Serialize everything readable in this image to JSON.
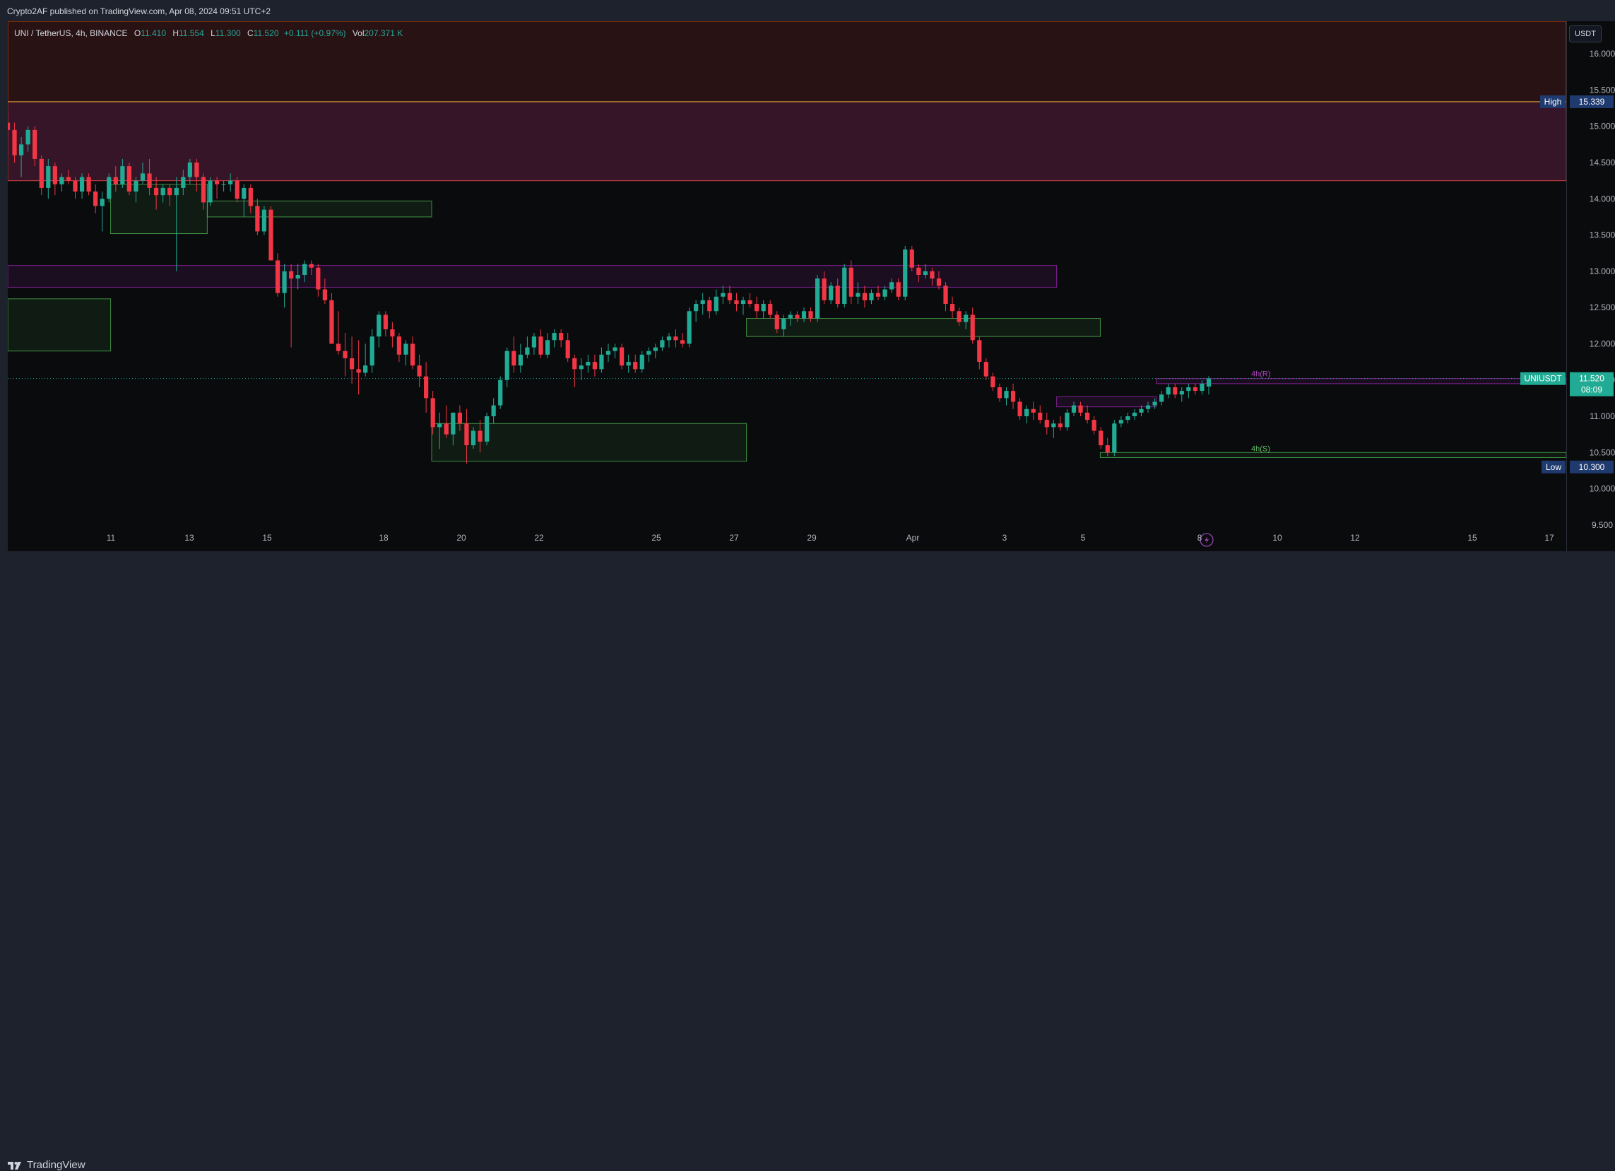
{
  "header": {
    "publisher_text": "Crypto2AF published on TradingView.com, Apr 08, 2024 09:51 UTC+2"
  },
  "legend": {
    "symbol": "UNI / TetherUS, 4h, BINANCE",
    "open_label": "O",
    "open": "11.410",
    "high_label": "H",
    "high": "11.554",
    "low_label": "L",
    "low": "11.300",
    "close_label": "C",
    "close": "11.520",
    "change": "+0.111 (+0.97%)",
    "vol_label": "Vol",
    "vol": "207.371 K"
  },
  "price_axis": {
    "currency": "USDT",
    "ticks": [
      "16.000",
      "15.500",
      "15.000",
      "14.500",
      "14.000",
      "13.500",
      "13.000",
      "12.500",
      "12.000",
      "11.500",
      "11.000",
      "10.500",
      "10.000",
      "9.500"
    ],
    "high_tag": {
      "label": "High",
      "value": "15.339"
    },
    "low_tag": {
      "label": "Low",
      "value": "10.300"
    },
    "last_tag": {
      "symbol": "UNIUSDT",
      "value": "11.520",
      "countdown": "08:09"
    }
  },
  "time_axis": {
    "ticks": [
      "11",
      "13",
      "15",
      "18",
      "20",
      "22",
      "25",
      "27",
      "29",
      "Apr",
      "3",
      "5",
      "8",
      "10",
      "12",
      "15",
      "17"
    ]
  },
  "annotations": {
    "resistance_label": "4h(R)",
    "support_label": "4h(S)"
  },
  "footer": {
    "brand": "TradingView"
  },
  "colors": {
    "up": "#22ab94",
    "down": "#f23645",
    "zone_purple": "#9c27b0",
    "zone_green": "#4caf50",
    "bg": "#0a0b0d"
  },
  "chart_data": {
    "type": "candlestick",
    "symbol": "UNIUSDT",
    "timeframe": "4h",
    "ylim": [
      9.45,
      16.45
    ],
    "x_range_days": [
      9.7,
      17.5
    ],
    "x_ticks": [
      "11",
      "13",
      "15",
      "18",
      "20",
      "22",
      "25",
      "27",
      "29",
      "Apr",
      "3",
      "5",
      "8",
      "10",
      "12",
      "15",
      "17"
    ],
    "last": {
      "open": 11.41,
      "high": 11.554,
      "low": 11.3,
      "close": 11.52
    },
    "range_high": 15.339,
    "range_low": 10.3,
    "zones": [
      {
        "kind": "supply",
        "from": "top",
        "y1": 14.25,
        "y2": 16.45
      },
      {
        "kind": "resistance",
        "y1": 12.78,
        "y2": 13.08,
        "x_start": 0,
        "x_end": 0.673
      },
      {
        "kind": "demand",
        "y1": 11.9,
        "y2": 12.62,
        "x_start": 0.0,
        "x_end": 0.066
      },
      {
        "kind": "demand",
        "y1": 13.52,
        "y2": 14.2,
        "x_start": 0.066,
        "x_end": 0.128
      },
      {
        "kind": "demand",
        "y1": 13.75,
        "y2": 13.97,
        "x_start": 0.128,
        "x_end": 0.272
      },
      {
        "kind": "demand",
        "y1": 10.38,
        "y2": 10.9,
        "x_start": 0.272,
        "x_end": 0.474
      },
      {
        "kind": "demand",
        "y1": 12.1,
        "y2": 12.35,
        "x_start": 0.474,
        "x_end": 0.701
      },
      {
        "kind": "resistance",
        "y1": 11.13,
        "y2": 11.27,
        "x_start": 0.673,
        "x_end": 0.737
      },
      {
        "kind": "4h_resistance",
        "y1": 11.45,
        "y2": 11.52,
        "x_start": 0.737,
        "x_end": 1.0
      },
      {
        "kind": "4h_support",
        "y1": 10.43,
        "y2": 10.5,
        "x_start": 0.701,
        "x_end": 1.0
      }
    ],
    "candles": [
      [
        15.05,
        15.2,
        14.6,
        14.95
      ],
      [
        14.95,
        15.05,
        14.5,
        14.6
      ],
      [
        14.6,
        14.85,
        14.3,
        14.75
      ],
      [
        14.75,
        15.0,
        14.65,
        14.95
      ],
      [
        14.95,
        15.0,
        14.45,
        14.55
      ],
      [
        14.55,
        14.6,
        14.05,
        14.15
      ],
      [
        14.15,
        14.55,
        14.0,
        14.45
      ],
      [
        14.45,
        14.5,
        14.05,
        14.2
      ],
      [
        14.2,
        14.35,
        14.1,
        14.3
      ],
      [
        14.3,
        14.4,
        14.2,
        14.25
      ],
      [
        14.25,
        14.3,
        14.0,
        14.1
      ],
      [
        14.1,
        14.35,
        14.0,
        14.3
      ],
      [
        14.3,
        14.35,
        14.05,
        14.1
      ],
      [
        14.1,
        14.2,
        13.8,
        13.9
      ],
      [
        13.9,
        14.1,
        13.55,
        14.0
      ],
      [
        14.0,
        14.35,
        13.95,
        14.3
      ],
      [
        14.3,
        14.45,
        14.1,
        14.2
      ],
      [
        14.2,
        14.55,
        14.15,
        14.45
      ],
      [
        14.45,
        14.5,
        14.05,
        14.1
      ],
      [
        14.1,
        14.3,
        13.95,
        14.25
      ],
      [
        14.25,
        14.5,
        14.2,
        14.35
      ],
      [
        14.35,
        14.55,
        14.05,
        14.15
      ],
      [
        14.15,
        14.3,
        13.85,
        14.05
      ],
      [
        14.05,
        14.2,
        13.95,
        14.15
      ],
      [
        14.15,
        14.2,
        13.9,
        14.05
      ],
      [
        14.05,
        14.3,
        13.0,
        14.15
      ],
      [
        14.15,
        14.4,
        14.05,
        14.3
      ],
      [
        14.3,
        14.55,
        14.2,
        14.5
      ],
      [
        14.5,
        14.55,
        14.1,
        14.3
      ],
      [
        14.3,
        14.35,
        13.85,
        13.95
      ],
      [
        13.95,
        14.3,
        13.9,
        14.25
      ],
      [
        14.25,
        14.3,
        14.0,
        14.2
      ],
      [
        14.2,
        14.25,
        14.1,
        14.2
      ],
      [
        14.2,
        14.35,
        14.1,
        14.25
      ],
      [
        14.25,
        14.3,
        13.95,
        14.0
      ],
      [
        14.0,
        14.2,
        13.75,
        14.15
      ],
      [
        14.15,
        14.2,
        13.8,
        13.9
      ],
      [
        13.9,
        14.0,
        13.5,
        13.55
      ],
      [
        13.55,
        13.9,
        13.5,
        13.85
      ],
      [
        13.85,
        13.9,
        13.2,
        13.15
      ],
      [
        13.15,
        13.25,
        12.65,
        12.7
      ],
      [
        12.7,
        13.1,
        12.5,
        13.0
      ],
      [
        13.0,
        13.1,
        11.95,
        12.9
      ],
      [
        12.9,
        13.1,
        12.75,
        12.95
      ],
      [
        12.95,
        13.15,
        12.85,
        13.1
      ],
      [
        13.1,
        13.15,
        12.95,
        13.05
      ],
      [
        13.05,
        13.1,
        12.65,
        12.75
      ],
      [
        12.75,
        12.9,
        12.55,
        12.6
      ],
      [
        12.6,
        12.7,
        12.0,
        12.0
      ],
      [
        12.0,
        12.45,
        11.85,
        11.9
      ],
      [
        11.9,
        12.15,
        11.55,
        11.8
      ],
      [
        11.8,
        12.1,
        11.45,
        11.65
      ],
      [
        11.65,
        12.05,
        11.3,
        11.6
      ],
      [
        11.6,
        12.0,
        11.55,
        11.7
      ],
      [
        11.7,
        12.2,
        11.6,
        12.1
      ],
      [
        12.1,
        12.45,
        11.95,
        12.4
      ],
      [
        12.4,
        12.45,
        12.1,
        12.2
      ],
      [
        12.2,
        12.3,
        11.95,
        12.1
      ],
      [
        12.1,
        12.15,
        11.75,
        11.85
      ],
      [
        11.85,
        12.05,
        11.7,
        12.0
      ],
      [
        12.0,
        12.1,
        11.65,
        11.7
      ],
      [
        11.7,
        11.85,
        11.4,
        11.55
      ],
      [
        11.55,
        11.75,
        11.05,
        11.25
      ],
      [
        11.25,
        11.35,
        10.75,
        10.85
      ],
      [
        10.85,
        11.05,
        10.55,
        10.9
      ],
      [
        10.9,
        11.15,
        10.7,
        10.75
      ],
      [
        10.75,
        11.05,
        10.6,
        11.05
      ],
      [
        11.05,
        11.15,
        10.8,
        10.9
      ],
      [
        10.9,
        11.1,
        10.35,
        10.6
      ],
      [
        10.6,
        10.85,
        10.55,
        10.8
      ],
      [
        10.8,
        10.95,
        10.5,
        10.65
      ],
      [
        10.65,
        11.05,
        10.6,
        11.0
      ],
      [
        11.0,
        11.25,
        10.9,
        11.15
      ],
      [
        11.15,
        11.55,
        11.1,
        11.5
      ],
      [
        11.5,
        11.95,
        11.4,
        11.9
      ],
      [
        11.9,
        12.1,
        11.6,
        11.7
      ],
      [
        11.7,
        12.0,
        11.6,
        11.85
      ],
      [
        11.85,
        12.1,
        11.8,
        11.95
      ],
      [
        11.95,
        12.15,
        11.85,
        12.1
      ],
      [
        12.1,
        12.2,
        11.8,
        11.85
      ],
      [
        11.85,
        12.15,
        11.8,
        12.05
      ],
      [
        12.05,
        12.2,
        11.95,
        12.15
      ],
      [
        12.15,
        12.2,
        11.95,
        12.05
      ],
      [
        12.05,
        12.15,
        11.75,
        11.8
      ],
      [
        11.8,
        11.85,
        11.4,
        11.65
      ],
      [
        11.65,
        11.8,
        11.5,
        11.7
      ],
      [
        11.7,
        11.85,
        11.6,
        11.75
      ],
      [
        11.75,
        11.85,
        11.55,
        11.65
      ],
      [
        11.65,
        11.95,
        11.6,
        11.85
      ],
      [
        11.85,
        12.0,
        11.75,
        11.9
      ],
      [
        11.9,
        12.0,
        11.8,
        11.95
      ],
      [
        11.95,
        12.0,
        11.65,
        11.7
      ],
      [
        11.7,
        11.85,
        11.6,
        11.75
      ],
      [
        11.75,
        11.85,
        11.6,
        11.65
      ],
      [
        11.65,
        11.9,
        11.6,
        11.85
      ],
      [
        11.85,
        11.95,
        11.75,
        11.9
      ],
      [
        11.9,
        12.0,
        11.8,
        11.95
      ],
      [
        11.95,
        12.1,
        11.9,
        12.05
      ],
      [
        12.05,
        12.15,
        11.95,
        12.1
      ],
      [
        12.1,
        12.2,
        11.95,
        12.05
      ],
      [
        12.05,
        12.15,
        11.95,
        12.0
      ],
      [
        12.0,
        12.5,
        11.95,
        12.45
      ],
      [
        12.45,
        12.6,
        12.3,
        12.55
      ],
      [
        12.55,
        12.7,
        12.4,
        12.6
      ],
      [
        12.6,
        12.65,
        12.35,
        12.45
      ],
      [
        12.45,
        12.75,
        12.4,
        12.65
      ],
      [
        12.65,
        12.8,
        12.55,
        12.7
      ],
      [
        12.7,
        12.8,
        12.55,
        12.6
      ],
      [
        12.6,
        12.7,
        12.45,
        12.55
      ],
      [
        12.55,
        12.65,
        12.4,
        12.6
      ],
      [
        12.6,
        12.7,
        12.5,
        12.55
      ],
      [
        12.55,
        12.65,
        12.35,
        12.45
      ],
      [
        12.45,
        12.6,
        12.35,
        12.55
      ],
      [
        12.55,
        12.6,
        12.35,
        12.4
      ],
      [
        12.4,
        12.45,
        12.15,
        12.2
      ],
      [
        12.2,
        12.4,
        12.1,
        12.35
      ],
      [
        12.35,
        12.45,
        12.25,
        12.4
      ],
      [
        12.4,
        12.45,
        12.3,
        12.35
      ],
      [
        12.35,
        12.5,
        12.3,
        12.45
      ],
      [
        12.45,
        12.5,
        12.3,
        12.35
      ],
      [
        12.35,
        12.95,
        12.3,
        12.9
      ],
      [
        12.9,
        13.0,
        12.55,
        12.6
      ],
      [
        12.6,
        12.85,
        12.55,
        12.8
      ],
      [
        12.8,
        12.9,
        12.5,
        12.55
      ],
      [
        12.55,
        13.1,
        12.5,
        13.05
      ],
      [
        13.05,
        13.15,
        12.55,
        12.65
      ],
      [
        12.65,
        12.85,
        12.55,
        12.7
      ],
      [
        12.7,
        12.8,
        12.5,
        12.6
      ],
      [
        12.6,
        12.75,
        12.55,
        12.7
      ],
      [
        12.7,
        12.8,
        12.6,
        12.65
      ],
      [
        12.65,
        12.8,
        12.6,
        12.75
      ],
      [
        12.75,
        12.9,
        12.7,
        12.85
      ],
      [
        12.85,
        12.9,
        12.6,
        12.65
      ],
      [
        12.65,
        13.35,
        12.6,
        13.3
      ],
      [
        13.3,
        13.35,
        13.0,
        13.05
      ],
      [
        13.05,
        13.1,
        12.85,
        12.95
      ],
      [
        12.95,
        13.1,
        12.9,
        13.0
      ],
      [
        13.0,
        13.05,
        12.8,
        12.9
      ],
      [
        12.9,
        13.0,
        12.75,
        12.8
      ],
      [
        12.8,
        12.85,
        12.45,
        12.55
      ],
      [
        12.55,
        12.65,
        12.35,
        12.45
      ],
      [
        12.45,
        12.5,
        12.25,
        12.3
      ],
      [
        12.3,
        12.45,
        12.2,
        12.4
      ],
      [
        12.4,
        12.5,
        12.0,
        12.05
      ],
      [
        12.05,
        12.1,
        11.65,
        11.75
      ],
      [
        11.75,
        11.8,
        11.5,
        11.55
      ],
      [
        11.55,
        11.6,
        11.35,
        11.4
      ],
      [
        11.4,
        11.45,
        11.2,
        11.25
      ],
      [
        11.25,
        11.4,
        11.15,
        11.35
      ],
      [
        11.35,
        11.45,
        11.1,
        11.2
      ],
      [
        11.2,
        11.25,
        10.95,
        11.0
      ],
      [
        11.0,
        11.15,
        10.9,
        11.1
      ],
      [
        11.1,
        11.2,
        10.95,
        11.05
      ],
      [
        11.05,
        11.15,
        10.9,
        10.95
      ],
      [
        10.95,
        11.05,
        10.75,
        10.85
      ],
      [
        10.85,
        10.95,
        10.7,
        10.9
      ],
      [
        10.9,
        11.0,
        10.8,
        10.85
      ],
      [
        10.85,
        11.1,
        10.8,
        11.05
      ],
      [
        11.05,
        11.2,
        11.0,
        11.15
      ],
      [
        11.15,
        11.2,
        11.0,
        11.05
      ],
      [
        11.05,
        11.15,
        10.9,
        10.95
      ],
      [
        10.95,
        11.0,
        10.75,
        10.8
      ],
      [
        10.8,
        10.85,
        10.55,
        10.6
      ],
      [
        10.6,
        10.7,
        10.45,
        10.5
      ],
      [
        10.5,
        10.95,
        10.45,
        10.9
      ],
      [
        10.9,
        11.0,
        10.85,
        10.95
      ],
      [
        10.95,
        11.05,
        10.9,
        11.0
      ],
      [
        11.0,
        11.1,
        10.95,
        11.05
      ],
      [
        11.05,
        11.15,
        11.0,
        11.1
      ],
      [
        11.1,
        11.2,
        11.05,
        11.15
      ],
      [
        11.15,
        11.25,
        11.1,
        11.2
      ],
      [
        11.2,
        11.35,
        11.15,
        11.3
      ],
      [
        11.3,
        11.45,
        11.25,
        11.4
      ],
      [
        11.4,
        11.45,
        11.25,
        11.3
      ],
      [
        11.3,
        11.4,
        11.2,
        11.35
      ],
      [
        11.35,
        11.45,
        11.25,
        11.4
      ],
      [
        11.4,
        11.45,
        11.3,
        11.35
      ],
      [
        11.35,
        11.5,
        11.3,
        11.45
      ],
      [
        11.41,
        11.554,
        11.3,
        11.52
      ]
    ]
  }
}
